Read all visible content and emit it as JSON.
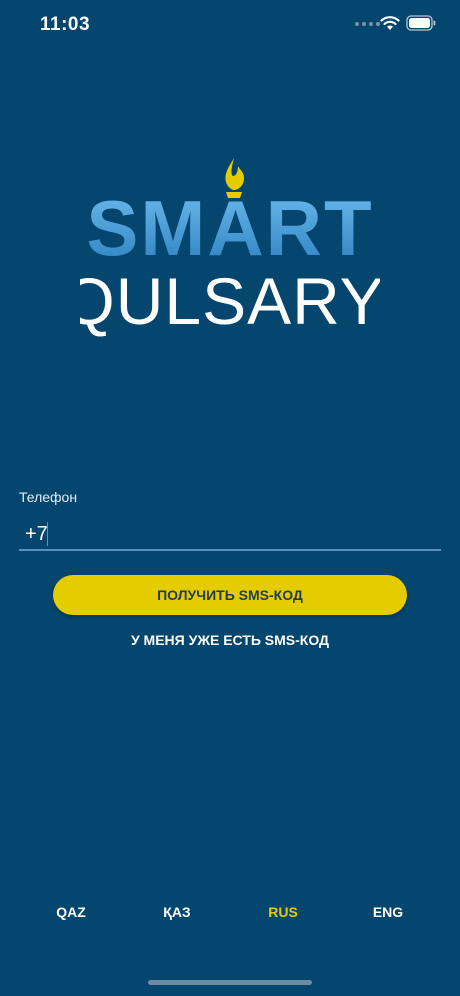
{
  "status_bar": {
    "time": "11:03"
  },
  "logo": {
    "line1": "SMART",
    "line2": "QULSARY"
  },
  "form": {
    "phone_label": "Телефон",
    "phone_value": "+7",
    "get_code_button": "ПОЛУЧИТЬ SMS-КОД",
    "have_code_link": "У МЕНЯ УЖЕ ЕСТЬ SMS-КОД"
  },
  "languages": [
    {
      "label": "QAZ",
      "active": false
    },
    {
      "label": "ҚАЗ",
      "active": false
    },
    {
      "label": "RUS",
      "active": true
    },
    {
      "label": "ENG",
      "active": false
    }
  ],
  "colors": {
    "background": "#05466f",
    "accent": "#e5cc00",
    "logo_blue": "#4aa3df"
  }
}
